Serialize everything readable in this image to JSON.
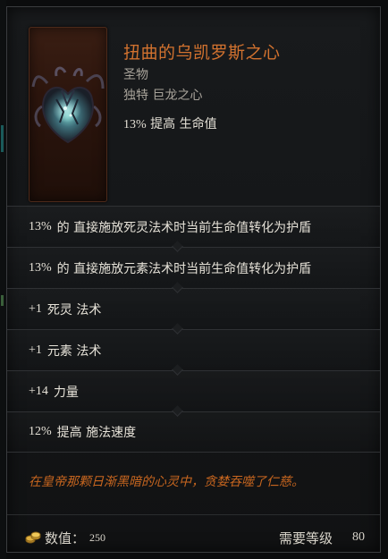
{
  "item": {
    "name": "扭曲的乌凯罗斯之心",
    "category": "圣物",
    "rarity_type": "独特 巨龙之心",
    "implicit": {
      "value": "13%",
      "text": "提高 生命值"
    },
    "modifiers": [
      {
        "value": "13%",
        "text": "的 直接施放死灵法术时当前生命值转化为护盾"
      },
      {
        "value": "13%",
        "text": "的 直接施放元素法术时当前生命值转化为护盾"
      },
      {
        "value": "+1",
        "text": "死灵 法术"
      },
      {
        "value": "+1",
        "text": "元素 法术"
      },
      {
        "value": "+14",
        "text": "力量"
      },
      {
        "value": "12%",
        "text": "提高 施法速度"
      }
    ],
    "flavour_text": "在皇帝那颗日渐黑暗的心灵中，贪婪吞噬了仁慈。",
    "value_label": "数值：",
    "value_amount": "250",
    "requirement_label": "需要等级",
    "requirement_level": "80"
  },
  "colors": {
    "unique_orange": "#d2722f",
    "flavour_orange": "#c8661f",
    "card_background": "#2c150d"
  },
  "icons": {
    "item": "dragon-heart-relic-icon",
    "currency": "gold-coin-icon"
  }
}
